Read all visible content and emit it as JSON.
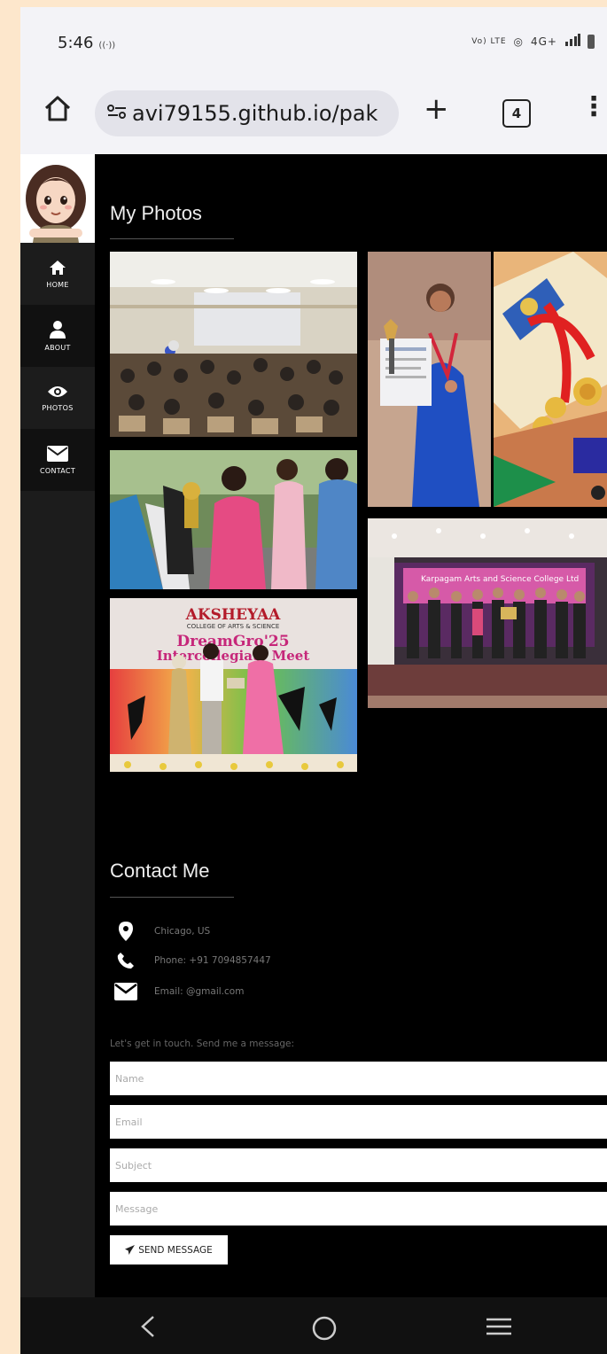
{
  "status_bar": {
    "time": "5:46",
    "hotspot_indicator": "((·))",
    "network": "4G+",
    "vo_lte": "Vo) LTE",
    "icons": [
      "volte-icon",
      "hotspot-icon",
      "signal-icon",
      "battery-icon"
    ]
  },
  "browser": {
    "url": "avi79155.github.io/pak",
    "tab_count": "4",
    "icons": [
      "home-icon",
      "site-settings-icon",
      "new-tab-plus-icon",
      "tabs-icon",
      "more-menu-icon"
    ]
  },
  "sidebar": {
    "items": [
      {
        "label": "HOME",
        "icon": "home-icon"
      },
      {
        "label": "ABOUT",
        "icon": "user-icon"
      },
      {
        "label": "PHOTOS",
        "icon": "eye-icon"
      },
      {
        "label": "CONTACT",
        "icon": "envelope-icon"
      }
    ]
  },
  "photos": {
    "title": "My Photos",
    "banner_college": "AKSHEYAA",
    "banner_subtitle": "COLLEGE OF ARTS & SCIENCE",
    "banner_event": "DreamGro'25",
    "banner_event2": "Intercollegiate Meet",
    "stage_banner": "Karpagam Arts and Science College Ltd"
  },
  "contact": {
    "title": "Contact Me",
    "location": "Chicago, US",
    "phone": "Phone: +91 7094857447",
    "email": "Email: @gmail.com",
    "lead": "Let's get in touch. Send me a message:",
    "name_placeholder": "Name",
    "email_placeholder": "Email",
    "subject_placeholder": "Subject",
    "message_placeholder": "Message",
    "send_label": "SEND MESSAGE"
  },
  "colors": {
    "page_bg": "#fde7cc",
    "sidebar_bg": "#1c1c1c",
    "main_bg": "#000000",
    "chrome_bg": "#f3f3f7"
  }
}
